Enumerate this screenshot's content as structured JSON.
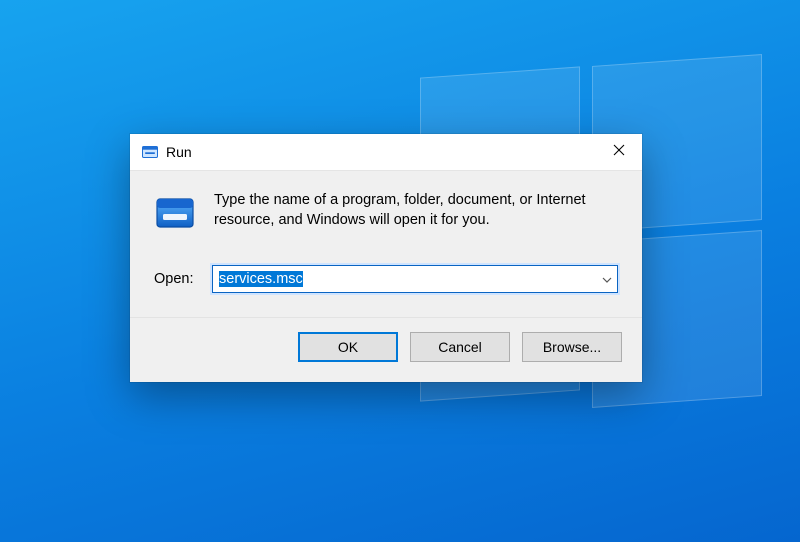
{
  "desktop": {
    "os": "Windows 10"
  },
  "dialog": {
    "title": "Run",
    "description": "Type the name of a program, folder, document, or Internet resource, and Windows will open it for you.",
    "open_label": "Open:",
    "open_value": "services.msc",
    "buttons": {
      "ok": "OK",
      "cancel": "Cancel",
      "browse": "Browse..."
    },
    "accent_color": "#0078d7"
  }
}
